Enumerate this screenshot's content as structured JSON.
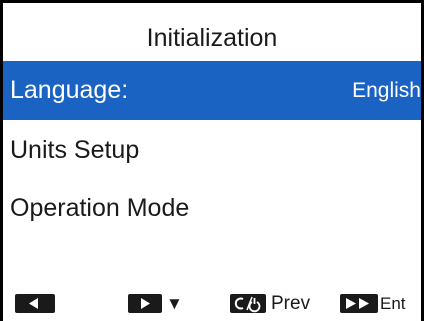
{
  "screen": {
    "title": "Initialization"
  },
  "menu": {
    "items": [
      {
        "label": "Language:",
        "value": "English",
        "selected": true
      },
      {
        "label": "Units Setup"
      },
      {
        "label": "Operation Mode"
      }
    ]
  },
  "footer": {
    "left_key_icon": "left-arrow-icon",
    "right_key_icon": "right-arrow-icon",
    "down_label": "▼",
    "clear_key_icon": "clear-power-icon",
    "prev_label": "Prev",
    "enter_key_icon": "double-right-arrow-icon",
    "ent_label": "Ent"
  },
  "colors": {
    "highlight": "#1b63c3",
    "text": "#1a1a1a"
  }
}
